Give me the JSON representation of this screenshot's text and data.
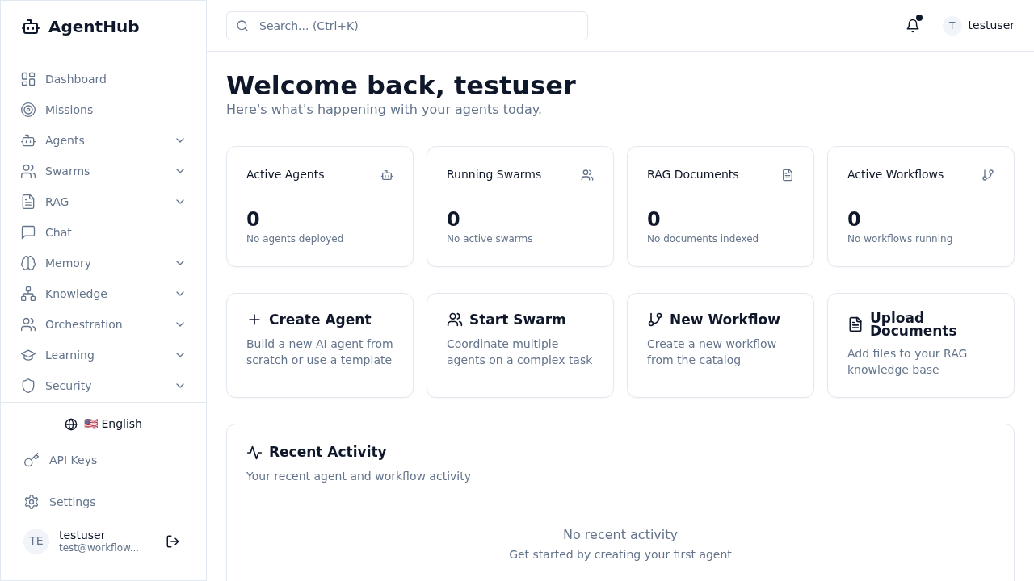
{
  "brand": {
    "name": "AgentHub"
  },
  "sidebar": {
    "items": [
      {
        "label": "Dashboard",
        "has_submenu": false
      },
      {
        "label": "Missions",
        "has_submenu": false
      },
      {
        "label": "Agents",
        "has_submenu": true
      },
      {
        "label": "Swarms",
        "has_submenu": true
      },
      {
        "label": "RAG",
        "has_submenu": true
      },
      {
        "label": "Chat",
        "has_submenu": false
      },
      {
        "label": "Memory",
        "has_submenu": true
      },
      {
        "label": "Knowledge",
        "has_submenu": true
      },
      {
        "label": "Orchestration",
        "has_submenu": true
      },
      {
        "label": "Learning",
        "has_submenu": true
      },
      {
        "label": "Security",
        "has_submenu": true
      }
    ],
    "language": "🇺🇸 English",
    "footer_links": [
      "API Keys",
      "Settings"
    ],
    "user": {
      "avatar": "TE",
      "name": "testuser",
      "email": "test@workflow..."
    }
  },
  "topbar": {
    "search": {
      "placeholder": "Search... (Ctrl+K)"
    },
    "has_notification": true,
    "user": {
      "avatar": "T",
      "name": "testuser"
    }
  },
  "heading": {
    "title": "Welcome back, testuser",
    "subtitle": "Here's what's happening with your agents today."
  },
  "stats": [
    {
      "title": "Active Agents",
      "value": "0",
      "note": "No agents deployed"
    },
    {
      "title": "Running Swarms",
      "value": "0",
      "note": "No active swarms"
    },
    {
      "title": "RAG Documents",
      "value": "0",
      "note": "No documents indexed"
    },
    {
      "title": "Active Workflows",
      "value": "0",
      "note": "No workflows running"
    }
  ],
  "actions": [
    {
      "title": "Create Agent",
      "description": "Build a new AI agent from scratch or use a template"
    },
    {
      "title": "Start Swarm",
      "description": "Coordinate multiple agents on a complex task"
    },
    {
      "title": "New Workflow",
      "description": "Create a new workflow from the catalog"
    },
    {
      "title": "Upload Documents",
      "description": "Add files to your RAG knowledge base"
    }
  ],
  "recent_activity": {
    "title": "Recent Activity",
    "subtitle": "Your recent agent and workflow activity",
    "empty_title": "No recent activity",
    "empty_hint": "Get started by creating your first agent"
  }
}
